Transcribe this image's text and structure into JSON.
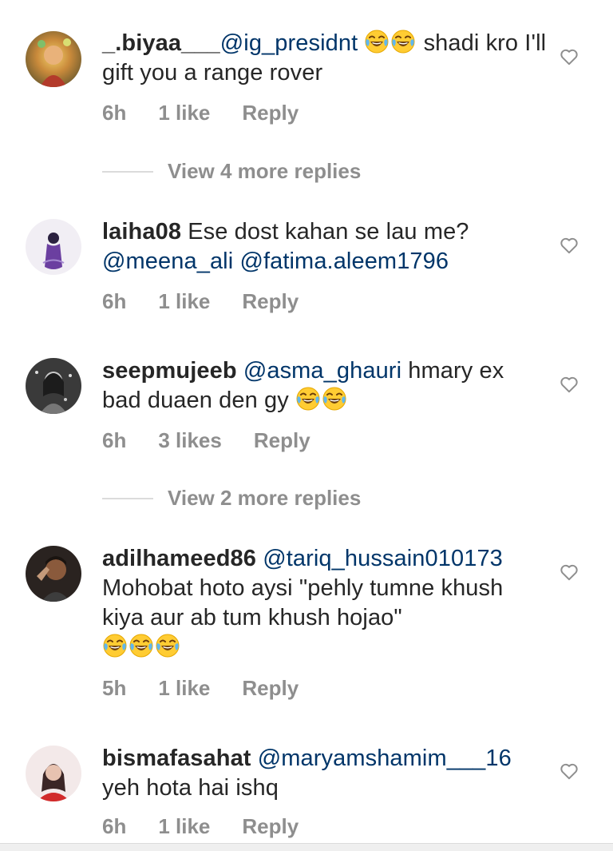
{
  "comments": [
    {
      "username": "_.biyaa___",
      "parts": [
        {
          "t": "mention",
          "v": "@ig_presidnt"
        },
        {
          "t": "text",
          "v": " "
        },
        {
          "t": "emoji",
          "v": "joy"
        },
        {
          "t": "emoji",
          "v": "joy"
        },
        {
          "t": "text",
          "v": " shadi kro I'll gift you a range rover"
        }
      ],
      "time": "6h",
      "likes": "1 like",
      "reply": "Reply",
      "view_replies": "View 4 more replies"
    },
    {
      "username": "laiha08",
      "parts": [
        {
          "t": "text",
          "v": " Ese dost kahan se lau me?"
        },
        {
          "t": "br"
        },
        {
          "t": "mention",
          "v": "@meena_ali"
        },
        {
          "t": "text",
          "v": " "
        },
        {
          "t": "mention",
          "v": "@fatima.aleem1796"
        }
      ],
      "time": "6h",
      "likes": "1 like",
      "reply": "Reply"
    },
    {
      "username": "seepmujeeb",
      "parts": [
        {
          "t": "text",
          "v": " "
        },
        {
          "t": "mention",
          "v": "@asma_ghauri"
        },
        {
          "t": "text",
          "v": "  hmary ex bad duaen den gy "
        },
        {
          "t": "emoji",
          "v": "joy"
        },
        {
          "t": "emoji",
          "v": "joy"
        }
      ],
      "time": "6h",
      "likes": "3 likes",
      "reply": "Reply",
      "view_replies": "View 2 more replies"
    },
    {
      "username": "adilhameed86",
      "parts": [
        {
          "t": "text",
          "v": " "
        },
        {
          "t": "mention",
          "v": "@tariq_hussain010173"
        },
        {
          "t": "br"
        },
        {
          "t": "text",
          "v": "Mohobat hoto aysi \"pehly tumne khush kiya aur ab tum khush hojao\""
        },
        {
          "t": "br"
        },
        {
          "t": "emoji",
          "v": "joy"
        },
        {
          "t": "emoji",
          "v": "joy"
        },
        {
          "t": "emoji",
          "v": "joy"
        }
      ],
      "time": "5h",
      "likes": "1 like",
      "reply": "Reply"
    },
    {
      "username": "bismafasahat",
      "parts": [
        {
          "t": "text",
          "v": " "
        },
        {
          "t": "mention",
          "v": "@maryamshamim___16"
        },
        {
          "t": "br"
        },
        {
          "t": "text",
          "v": "yeh hota hai ishq"
        }
      ],
      "time": "6h",
      "likes": "1 like",
      "reply": "Reply"
    }
  ],
  "icons": {
    "like": "heart-outline-icon",
    "emoji": "face-with-tears-of-joy-icon"
  },
  "colors": {
    "text": "#262626",
    "mention": "#003569",
    "meta": "#8e8e8e",
    "divider": "#dbdbdb"
  }
}
